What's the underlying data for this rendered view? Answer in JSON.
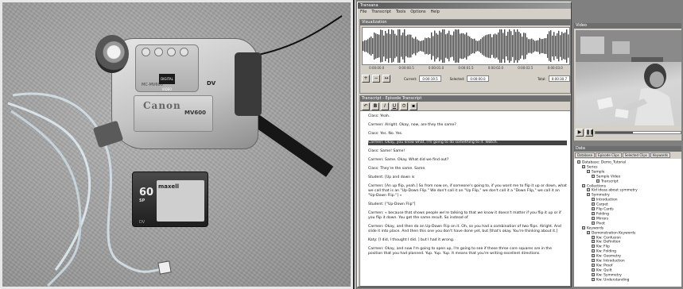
{
  "camcorder": {
    "brand": "Canon",
    "model": "MV600",
    "sublabel": "MC-MV600",
    "logo_text": "DIGITAL VIDEO",
    "format_mark": "DV"
  },
  "tape": {
    "capacity": "60",
    "capacity_unit": "SP",
    "brand": "maxell",
    "format_mark": "DV"
  },
  "app": {
    "title": "Transana",
    "menu": [
      "File",
      "Transcript",
      "Tools",
      "Options",
      "Help"
    ]
  },
  "audio_panel": {
    "title": "Visualization",
    "time_ticks": [
      "0:00:00.0",
      "0:00:00.5",
      "0:00:01.0",
      "0:00:01.5",
      "0:00:02.0",
      "0:00:02.5",
      "0:00:03.0"
    ],
    "current_label": "Current:",
    "current_value": "0:00:19.5",
    "selected_label": "Selected:",
    "selected_value": "0:00:00.0",
    "total_label": "Total:",
    "total_value": "0:00:30.7"
  },
  "transcript": {
    "title": "Transcript - Episode Transcript",
    "lines": [
      {
        "text": "Class:  Yeah.",
        "selected": false
      },
      {
        "text": "Carmen:  Alright.  Okay, now, are they the same?",
        "selected": false
      },
      {
        "text": "Class:  Yes.  No.  Yes.",
        "selected": false
      },
      {
        "text": "Carmen:  Okay, you know what, I'm going to do something to it.  Watch.",
        "selected": true
      },
      {
        "text": "Class:  Same!  Same!",
        "selected": false
      },
      {
        "text": "Carmen:  Same.  Okay.  What did we find out?",
        "selected": false
      },
      {
        "text": "Class:  They're the same.  Same.",
        "selected": false
      },
      {
        "text": "Student:  [Up and down is",
        "selected": false
      },
      {
        "text": "Carmen:  [An up flip, yeah.]  So from now on, if someone's going to, if you want me to flip it up or down, what we call that is an \"Up-Down Flip.\"  We don't call it an \"Up Flip,\" we don't call it a \"Down Flip,\" we call it an \"Up-Down Flip.\"] »",
        "selected": false
      },
      {
        "text": "Student:                                     [\"Up-Down Flip\"]",
        "selected": false
      },
      {
        "text": "Carmen:  « because that shows people we're talking to that we know it doesn't matter if you flip it up or if you flip it down.  You get the same result.  So instead of",
        "selected": false
      },
      {
        "text": "Carmen:  Okay, and then do an Up-Down Flip on it.  Oh, so you had a combination of two flips.  Alright.  And slide it into place.  And then this one you don't have done yet, but   [that's okay.  You're thinking about it.]",
        "selected": false
      },
      {
        "text": "Katy:  [I did, I thought I did.                              ] but I had it wrong.",
        "selected": false
      },
      {
        "text": "Carmen:  Okay, and now I'm going to open up, I'm going to see if these three core squares are in the position that you had planned.  Yup.  Yup.  Yup.  It means that you're writing excellent directions.",
        "selected": false
      }
    ]
  },
  "video_panel": {
    "title": "Video"
  },
  "data_tree": {
    "title": "Data",
    "tabs": [
      "Database",
      "Episode Clips",
      "Selected Clips",
      "Keywords"
    ],
    "nodes": [
      {
        "label": "Database: Demo_Tutorial",
        "depth": 0
      },
      {
        "label": "Series",
        "depth": 1
      },
      {
        "label": "Sample",
        "depth": 2
      },
      {
        "label": "Sample Video",
        "depth": 3
      },
      {
        "label": "Transcript",
        "depth": 4
      },
      {
        "label": "Collections",
        "depth": 1
      },
      {
        "label": "Kid ideas about symmetry",
        "depth": 2
      },
      {
        "label": "Symmetry",
        "depth": 2
      },
      {
        "label": "Introduction",
        "depth": 3
      },
      {
        "label": "Carpet",
        "depth": 3
      },
      {
        "label": "Flip Cards",
        "depth": 3
      },
      {
        "label": "Folding",
        "depth": 3
      },
      {
        "label": "Mirrors",
        "depth": 3
      },
      {
        "label": "Pivot",
        "depth": 3
      },
      {
        "label": "Keywords",
        "depth": 1
      },
      {
        "label": "Demonstration Keywords",
        "depth": 2
      },
      {
        "label": "Kw: Confusion",
        "depth": 3
      },
      {
        "label": "Kw: Definition",
        "depth": 3
      },
      {
        "label": "Kw: Flip",
        "depth": 3
      },
      {
        "label": "Kw: Folding",
        "depth": 3
      },
      {
        "label": "Kw: Geometry",
        "depth": 3
      },
      {
        "label": "Kw: Introduction",
        "depth": 3
      },
      {
        "label": "Kw: Proof",
        "depth": 3
      },
      {
        "label": "Kw: Quilt",
        "depth": 3
      },
      {
        "label": "Kw: Symmetry",
        "depth": 3
      },
      {
        "label": "Kw: Understanding",
        "depth": 3
      }
    ]
  }
}
